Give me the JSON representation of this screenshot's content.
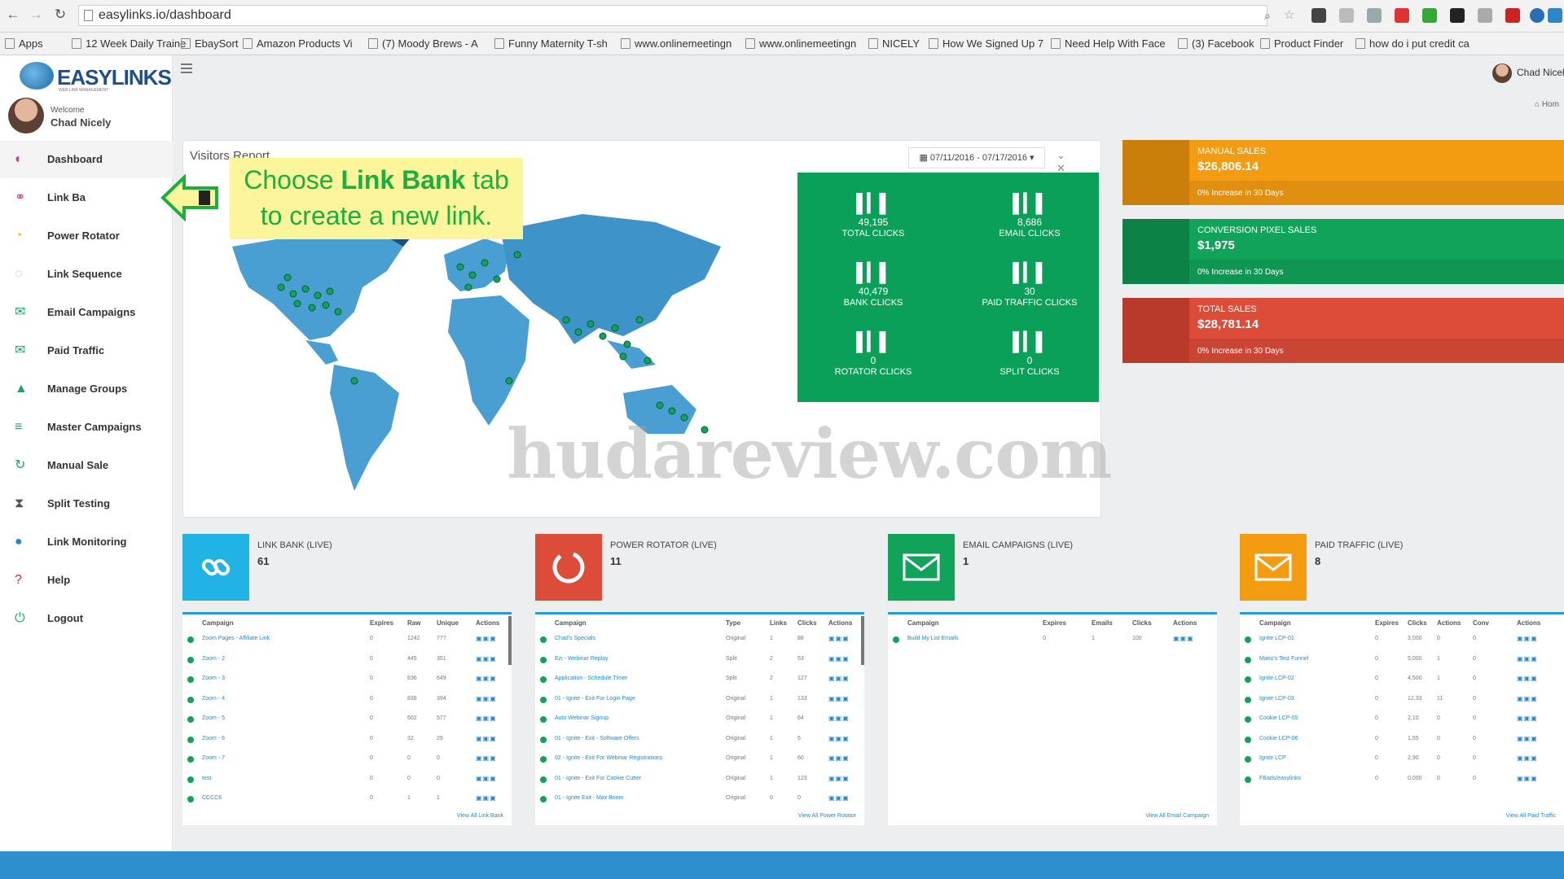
{
  "browser": {
    "url": "easylinks.io/dashboard",
    "bookmarks": [
      "Apps",
      "12 Week Daily Traine",
      "EbaySort",
      "Amazon Products Vi",
      "(7) Moody Brews - A",
      "Funny Maternity T-sh",
      "www.onlinemeetingn",
      "www.onlinemeetingn",
      "NICELY",
      "How We Signed Up 7",
      "Need Help With Face",
      "(3) Facebook",
      "Product Finder",
      "how do i put credit ca"
    ]
  },
  "brand": {
    "name": "EASYLINKS",
    "tagline": "WEB LINK MANAGEMENT"
  },
  "user": {
    "welcome": "Welcome",
    "name": "Chad Nicely",
    "top_name": "Chad Nicel"
  },
  "breadcrumb": "Hom",
  "sidebar": {
    "items": [
      {
        "label": "Dashboard",
        "icon": "dashboard-icon",
        "color": "#e0338c"
      },
      {
        "label": "Link Ba",
        "icon": "link-icon",
        "color": "#e0338c"
      },
      {
        "label": "Power Rotator",
        "icon": "power-rotator-icon",
        "color": "#f4c400"
      },
      {
        "label": "Link Sequence",
        "icon": "sequence-icon",
        "color": "#aaaaaa"
      },
      {
        "label": "Email Campaigns",
        "icon": "email-icon",
        "color": "#1aa866"
      },
      {
        "label": "Paid Traffic",
        "icon": "paid-traffic-icon",
        "color": "#1aa866"
      },
      {
        "label": "Manage Groups",
        "icon": "groups-icon",
        "color": "#1aa866"
      },
      {
        "label": "Master Campaigns",
        "icon": "list-icon",
        "color": "#1aa866"
      },
      {
        "label": "Manual Sale",
        "icon": "refresh-icon",
        "color": "#1aa866"
      },
      {
        "label": "Split Testing",
        "icon": "hourglass-icon",
        "color": "#555555"
      },
      {
        "label": "Link Monitoring",
        "icon": "globe-icon",
        "color": "#2a88c8"
      },
      {
        "label": "Help",
        "icon": "help-icon",
        "color": "#d9262b"
      },
      {
        "label": "Logout",
        "icon": "power-icon",
        "color": "#1aa866"
      }
    ]
  },
  "callout": {
    "pre": "Choose ",
    "bold": "Link Bank",
    "post": " tab",
    "line2": "to create a new link."
  },
  "visitors": {
    "title": "Visitors Report",
    "date_range": "07/11/2016 - 07/17/2016",
    "controls": "⌄ ✕"
  },
  "stats": [
    {
      "value": "49,195",
      "label": "TOTAL CLICKS"
    },
    {
      "value": "8,686",
      "label": "EMAIL CLICKS"
    },
    {
      "value": "40,479",
      "label": "BANK CLICKS"
    },
    {
      "value": "30",
      "label": "PAID TRAFFIC CLICKS"
    },
    {
      "value": "0",
      "label": "ROTATOR CLICKS"
    },
    {
      "value": "0",
      "label": "SPLIT CLICKS"
    }
  ],
  "kpis": [
    {
      "title": "MANUAL SALES",
      "value": "$26,806.14",
      "sub": "0% Increase in 30 Days",
      "color": "#f39c12",
      "dark": "#c97f09"
    },
    {
      "title": "CONVERSION PIXEL SALES",
      "value": "$1,975",
      "sub": "0% Increase in 30 Days",
      "color": "#12a35b",
      "dark": "#0c8246"
    },
    {
      "title": "TOTAL SALES",
      "value": "$28,781.14",
      "sub": "0% Increase in 30 Days",
      "color": "#dd4b39",
      "dark": "#b83a2b"
    }
  ],
  "watermark": "hudareview.com",
  "cards": [
    {
      "title": "LINK BANK (LIVE)",
      "count": "61",
      "color": "#22b3e6",
      "icon": "link-icon",
      "columns": [
        "Campaign",
        "Expires",
        "Raw",
        "Unique",
        "Actions"
      ],
      "rows": [
        [
          "Zoom Pages - Affiliate Link",
          "0",
          "1242",
          "777"
        ],
        [
          "Zoom - 2",
          "0",
          "445",
          "351"
        ],
        [
          "Zoom - 3",
          "0",
          "836",
          "649"
        ],
        [
          "Zoom - 4",
          "0",
          "838",
          "394"
        ],
        [
          "Zoom - 5",
          "0",
          "602",
          "577"
        ],
        [
          "Zoom - 6",
          "0",
          "32",
          "29"
        ],
        [
          "Zoom - 7",
          "0",
          "0",
          "0"
        ],
        [
          "test",
          "0",
          "0",
          "0"
        ],
        [
          "CCCC6",
          "0",
          "1",
          "1"
        ]
      ],
      "footer": "View All Link Bank"
    },
    {
      "title": "POWER ROTATOR (LIVE)",
      "count": "11",
      "color": "#dd4b39",
      "icon": "power-rotator-icon",
      "columns": [
        "Campaign",
        "Type",
        "Links",
        "Clicks",
        "Actions"
      ],
      "rows": [
        [
          "Chad's Specials",
          "Original",
          "1",
          "88"
        ],
        [
          "Ezi - Webinar Replay",
          "Split",
          "2",
          "53"
        ],
        [
          "Application - Schedule Timer",
          "Split",
          "2",
          "127"
        ],
        [
          "01 - Ignite - Exit For Login Page",
          "Original",
          "1",
          "133"
        ],
        [
          "Auto Webinar Signup",
          "Original",
          "1",
          "64"
        ],
        [
          "01 - Ignite - Exit - Software Offers",
          "Original",
          "1",
          "5"
        ],
        [
          "02 - Ignite - Exit For Webinar Registrations",
          "Original",
          "1",
          "60"
        ],
        [
          "01 - Ignite - Exit For Cookie Cutter",
          "Original",
          "1",
          "123"
        ],
        [
          "01 - Ignite Exit - Max Boom",
          "Original",
          "0",
          "0"
        ]
      ],
      "footer": "View All Power Rotator"
    },
    {
      "title": "EMAIL CAMPAIGNS (LIVE)",
      "count": "1",
      "color": "#12a35b",
      "icon": "email-icon",
      "columns": [
        "Campaign",
        "Expires",
        "Emails",
        "Clicks",
        "Actions"
      ],
      "rows": [
        [
          "Build My List Emails",
          "0",
          "1",
          "100"
        ]
      ],
      "footer": "View All Email Campaign"
    },
    {
      "title": "PAID TRAFFIC (LIVE)",
      "count": "8",
      "color": "#f39c12",
      "icon": "email-icon",
      "columns": [
        "Campaign",
        "Expires",
        "Clicks",
        "Actions",
        "Conv",
        "Actions"
      ],
      "rows": [
        [
          "Ignite LCP-01",
          "0",
          "3,000",
          "0",
          "0"
        ],
        [
          "Mario's Test Funnel",
          "0",
          "5,000",
          "1",
          "0"
        ],
        [
          "Ignite LCP-02",
          "0",
          "4,500",
          "1",
          "0"
        ],
        [
          "Ignite LCP-03",
          "0",
          "12,33",
          "11",
          "0"
        ],
        [
          "Cookie LCP-05",
          "0",
          "2,10",
          "0",
          "0"
        ],
        [
          "Cookie LCP-06",
          "0",
          "1,55",
          "0",
          "0"
        ],
        [
          "Ignite LCP",
          "0",
          "2,90",
          "0",
          "0"
        ],
        [
          "FBads/easylinks",
          "0",
          "0,000",
          "0",
          "0"
        ]
      ],
      "footer": "View All Paid Traffic"
    }
  ]
}
